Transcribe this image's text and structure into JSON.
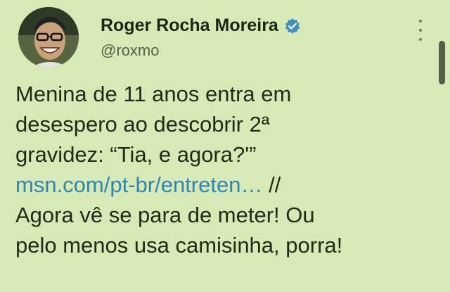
{
  "tweet": {
    "display_name": "Roger Rocha Moreira",
    "handle": "@roxmo",
    "text_lines": [
      "Menina de 11 anos entra em",
      "desespero ao descobrir 2ª",
      "gravidez: “Tia, e agora?'”"
    ],
    "link": "msn.com/pt-br/entreten…",
    "link_suffix": " //",
    "text_lines_after": [
      "Agora vê se para de meter! Ou",
      "pelo menos usa camisinha, porra!"
    ]
  },
  "icons": {
    "verified": "verified-badge-icon",
    "more": "more-options-icon"
  },
  "colors": {
    "background": "#d7e9b5",
    "link": "#2f86b5",
    "verified": "#3f8fc4"
  }
}
